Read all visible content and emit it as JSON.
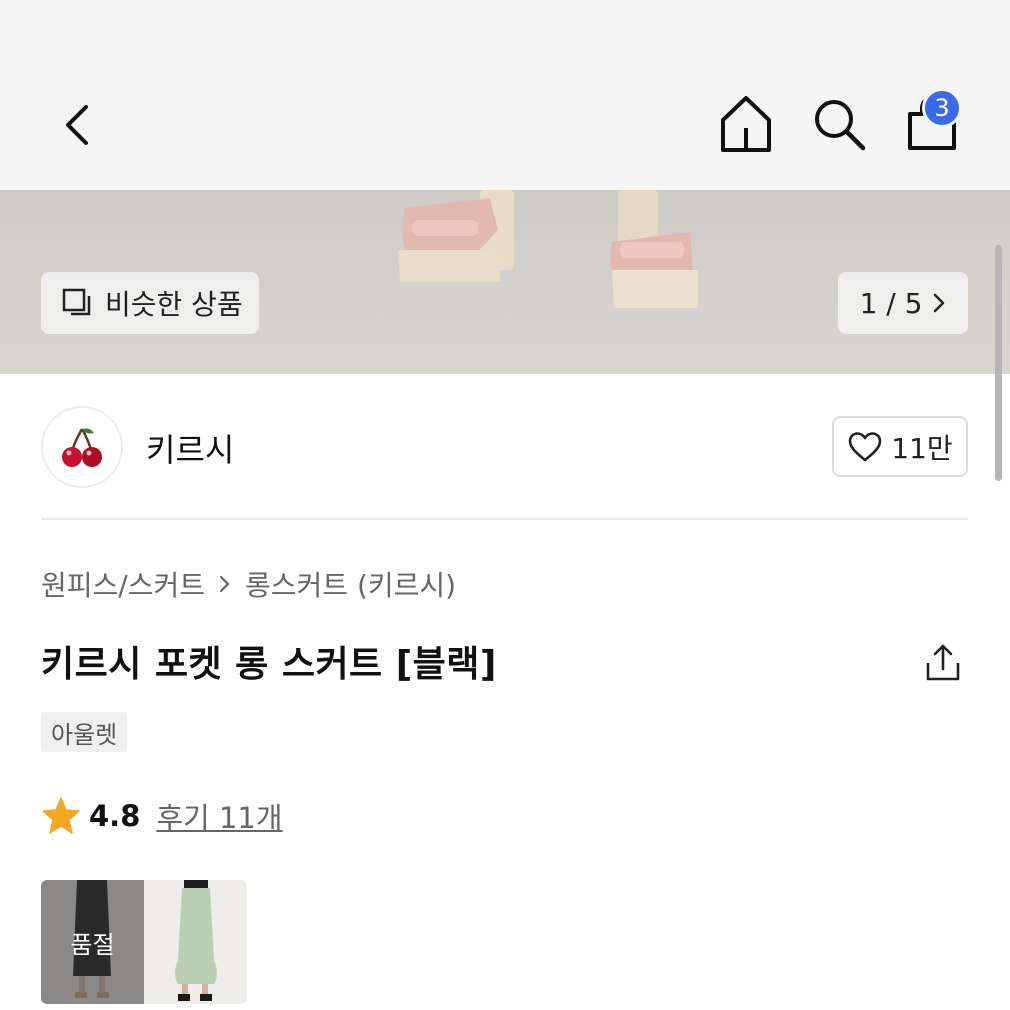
{
  "topbar": {
    "back_icon": "chevron-left-icon",
    "home_icon": "home-icon",
    "search_icon": "search-icon",
    "cart_icon": "shopping-bag-icon",
    "cart_count": "3",
    "badge_color": "#3b6ae8"
  },
  "hero": {
    "similar_label": "비슷한 상품",
    "pager": "1 / 5"
  },
  "shop": {
    "name": "키르시",
    "likes": "11만",
    "logo_icon": "cherry-icon"
  },
  "product": {
    "breadcrumb": [
      "원피스/스커트",
      "롱스커트 (키르시)"
    ],
    "title": "키르시 포켓 롱 스커트 [블랙]",
    "tag": "아울렛",
    "rating": "4.8",
    "reviews": "후기 11개",
    "rating_color": "#f5a623"
  },
  "variants": [
    {
      "color": "black",
      "status": "품절"
    },
    {
      "color": "mint",
      "status": ""
    }
  ]
}
